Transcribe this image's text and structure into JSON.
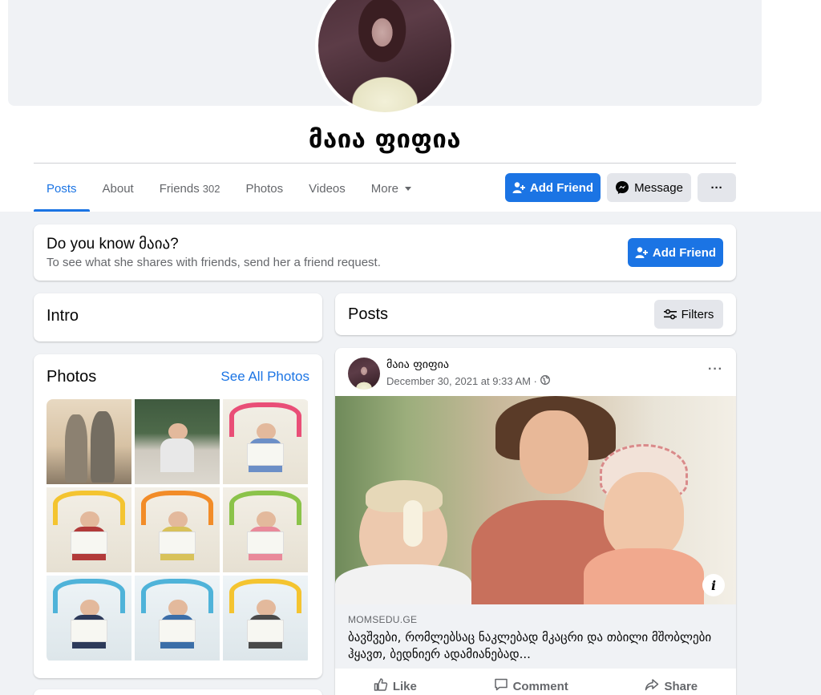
{
  "profile": {
    "name": "მაია ფიფია"
  },
  "tabs": [
    {
      "label": "Posts"
    },
    {
      "label": "About"
    },
    {
      "label": "Friends",
      "count": "302"
    },
    {
      "label": "Photos"
    },
    {
      "label": "Videos"
    },
    {
      "label": "More"
    }
  ],
  "header_actions": {
    "add_friend": "Add Friend",
    "message": "Message",
    "more": "···"
  },
  "know_card": {
    "title": "Do you know მაია?",
    "subtitle": "To see what she shares with friends, send her a friend request.",
    "button": "Add Friend"
  },
  "intro": {
    "title": "Intro"
  },
  "photos": {
    "title": "Photos",
    "see_all": "See All Photos"
  },
  "posts_header": {
    "title": "Posts",
    "filters": "Filters"
  },
  "post": {
    "author": "მაია ფიფია",
    "date": "December 30, 2021 at 9:33 AM ·",
    "more": "···",
    "link_domain": "MOMSEDU.GE",
    "link_title": "ბავშვები, რომლებსაც ნაკლებად მკაცრი და თბილი მშობლები ჰყავთ, ბედნიერ ადამიანებად...",
    "info": "i",
    "actions": {
      "like": "Like",
      "comment": "Comment",
      "share": "Share"
    }
  },
  "colors": {
    "accent": "#1b74e4",
    "background": "#f0f2f5",
    "secondary_text": "#65676b"
  }
}
